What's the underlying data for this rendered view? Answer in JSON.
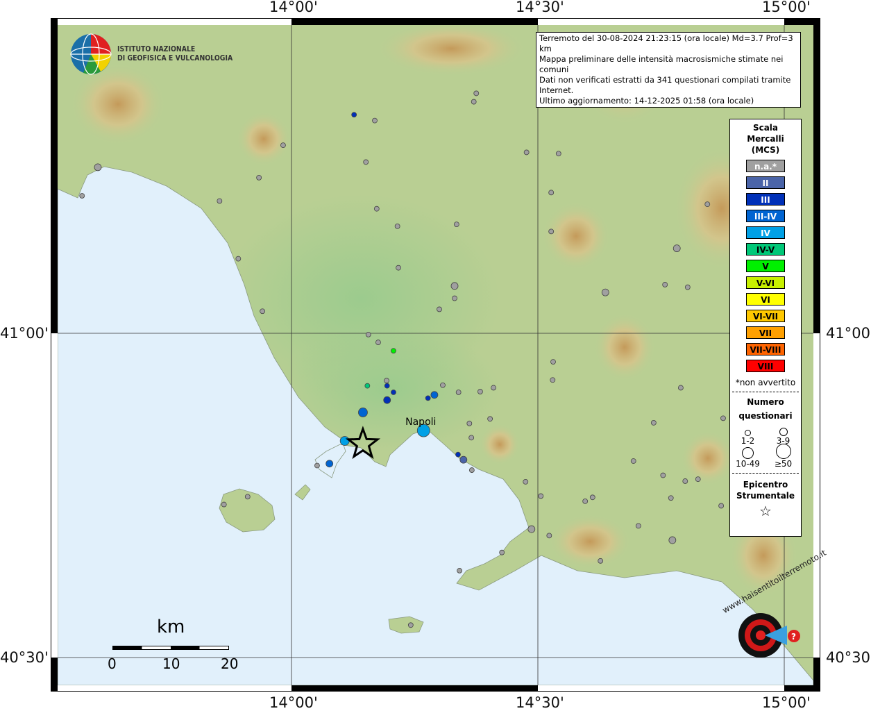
{
  "axes": {
    "top": [
      "14°00'",
      "14°30'",
      "15°00'"
    ],
    "bottom": [
      "14°00'",
      "14°30'",
      "15°00'"
    ],
    "left": [
      "41°00'",
      "40°30'"
    ],
    "right": [
      "41°00'",
      "40°30'"
    ]
  },
  "logo": {
    "line1": "ISTITUTO NAZIONALE",
    "line2": "DI GEOFISICA E VULCANOLOGIA"
  },
  "info": [
    "Terremoto del 30-08-2024 21:23:15 (ora locale) Md=3.7 Prof=3 km",
    "Mappa preliminare delle intensità macrosismiche stimate nei comuni",
    "Dati non verificati estratti da 341 questionari compilati tramite Internet.",
    "Ultimo aggiornamento: 14-12-2025 01:58 (ora locale)"
  ],
  "legend": {
    "title1": "Scala",
    "title2": "Mercalli",
    "title3": "(MCS)",
    "classes": [
      {
        "label": "n.a.*",
        "color": "#a0a0a0",
        "text": "#fff"
      },
      {
        "label": "II",
        "color": "#4a64a8",
        "text": "#fff"
      },
      {
        "label": "III",
        "color": "#0030b8",
        "text": "#fff"
      },
      {
        "label": "III-IV",
        "color": "#0064d2",
        "text": "#fff"
      },
      {
        "label": "IV",
        "color": "#00a0e6",
        "text": "#fff"
      },
      {
        "label": "IV-V",
        "color": "#00c878",
        "text": "#000"
      },
      {
        "label": "V",
        "color": "#00f000",
        "text": "#000"
      },
      {
        "label": "V-VI",
        "color": "#c8f000",
        "text": "#000"
      },
      {
        "label": "VI",
        "color": "#ffff00",
        "text": "#000"
      },
      {
        "label": "VI-VII",
        "color": "#ffc800",
        "text": "#000"
      },
      {
        "label": "VII",
        "color": "#ffa000",
        "text": "#000"
      },
      {
        "label": "VII-VIII",
        "color": "#ff6400",
        "text": "#000"
      },
      {
        "label": "VIII",
        "color": "#ff0000",
        "text": "#000"
      }
    ],
    "note": "*non avvertito",
    "num1": "Numero",
    "num2": "questionari",
    "sizes": [
      "1-2",
      "3-9",
      "10-49",
      "≥50"
    ],
    "epi1": "Epicentro",
    "epi2": "Strumentale"
  },
  "city": {
    "name": "Napoli",
    "lon": 14.268,
    "lat": 40.852
  },
  "epicenter": {
    "lon": 14.145,
    "lat": 40.829
  },
  "scale": {
    "unit": "km",
    "labels": [
      "0",
      "10",
      "20"
    ]
  },
  "brand": "www.haisentitoilterremoto.it",
  "points": [
    [
      14.127,
      41.337,
      "III",
      "1-2"
    ],
    [
      14.169,
      41.328,
      "n.a.",
      "1-2"
    ],
    [
      13.983,
      41.29,
      "n.a.",
      "1-2"
    ],
    [
      13.934,
      41.24,
      "n.a.",
      "1-2"
    ],
    [
      13.854,
      41.204,
      "n.a.",
      "1-2"
    ],
    [
      13.892,
      41.115,
      "n.a.",
      "1-2"
    ],
    [
      13.941,
      41.034,
      "n.a.",
      "1-2"
    ],
    [
      14.151,
      41.264,
      "n.a.",
      "1-2"
    ],
    [
      14.173,
      41.192,
      "n.a.",
      "1-2"
    ],
    [
      14.215,
      41.165,
      "n.a.",
      "1-2"
    ],
    [
      14.335,
      41.168,
      "n.a.",
      "1-2"
    ],
    [
      14.217,
      41.101,
      "n.a.",
      "1-2"
    ],
    [
      14.331,
      41.054,
      "n.a.",
      "1-2"
    ],
    [
      14.3,
      41.037,
      "n.a.",
      "1-2"
    ],
    [
      14.156,
      40.998,
      "n.a.",
      "1-2"
    ],
    [
      14.176,
      40.986,
      "n.a.",
      "1-2"
    ],
    [
      14.375,
      41.37,
      "n.a.",
      "1-2"
    ],
    [
      14.37,
      41.357,
      "n.a.",
      "1-2"
    ],
    [
      14.477,
      41.279,
      "n.a.",
      "1-2"
    ],
    [
      14.542,
      41.277,
      "n.a.",
      "1-2"
    ],
    [
      14.527,
      41.217,
      "n.a.",
      "1-2"
    ],
    [
      14.844,
      41.199,
      "n.a.",
      "1-2"
    ],
    [
      14.527,
      41.157,
      "n.a.",
      "1-2"
    ],
    [
      14.758,
      41.075,
      "n.a.",
      "1-2"
    ],
    [
      14.804,
      41.071,
      "n.a.",
      "1-2"
    ],
    [
      14.531,
      40.956,
      "n.a.",
      "1-2"
    ],
    [
      14.53,
      40.928,
      "n.a.",
      "1-2"
    ],
    [
      14.79,
      40.916,
      "n.a.",
      "1-2"
    ],
    [
      14.876,
      40.869,
      "n.a.",
      "1-2"
    ],
    [
      14.735,
      40.862,
      "n.a.",
      "1-2"
    ],
    [
      14.694,
      40.803,
      "n.a.",
      "1-2"
    ],
    [
      14.754,
      40.781,
      "n.a.",
      "1-2"
    ],
    [
      14.799,
      40.772,
      "n.a.",
      "1-2"
    ],
    [
      14.825,
      40.775,
      "n.a.",
      "1-2"
    ],
    [
      14.872,
      40.734,
      "n.a.",
      "1-2"
    ],
    [
      14.77,
      40.746,
      "n.a.",
      "1-2"
    ],
    [
      14.704,
      40.703,
      "n.a.",
      "1-2"
    ],
    [
      14.611,
      40.747,
      "n.a.",
      "1-2"
    ],
    [
      14.596,
      40.741,
      "n.a.",
      "1-2"
    ],
    [
      14.627,
      40.649,
      "n.a.",
      "1-2"
    ],
    [
      14.523,
      40.688,
      "n.a.",
      "1-2"
    ],
    [
      14.506,
      40.749,
      "n.a.",
      "1-2"
    ],
    [
      14.475,
      40.771,
      "n.a.",
      "1-2"
    ],
    [
      14.427,
      40.662,
      "n.a.",
      "1-2"
    ],
    [
      14.341,
      40.634,
      "n.a.",
      "1-2"
    ],
    [
      14.403,
      40.868,
      "n.a.",
      "1-2"
    ],
    [
      14.361,
      40.861,
      "n.a.",
      "1-2"
    ],
    [
      14.365,
      40.839,
      "n.a.",
      "1-2"
    ],
    [
      14.339,
      40.909,
      "n.a.",
      "1-2"
    ],
    [
      14.383,
      40.91,
      "n.a.",
      "1-2"
    ],
    [
      14.41,
      40.916,
      "n.a.",
      "1-2"
    ],
    [
      14.307,
      40.92,
      "n.a.",
      "1-2"
    ],
    [
      14.366,
      40.789,
      "n.a.",
      "1-2"
    ],
    [
      14.052,
      40.796,
      "n.a.",
      "1-2"
    ],
    [
      13.911,
      40.748,
      "n.a.",
      "1-2"
    ],
    [
      13.863,
      40.736,
      "n.a.",
      "1-2"
    ],
    [
      13.575,
      41.212,
      "n.a.",
      "1-2"
    ],
    [
      14.242,
      40.55,
      "n.a.",
      "1-2"
    ],
    [
      14.193,
      40.927,
      "n.a.",
      "1-2"
    ],
    [
      13.607,
      41.256,
      "n.a.",
      "3-9"
    ],
    [
      14.331,
      41.073,
      "n.a.",
      "3-9"
    ],
    [
      14.782,
      41.131,
      "n.a.",
      "3-9"
    ],
    [
      14.637,
      41.063,
      "n.a.",
      "3-9"
    ],
    [
      14.487,
      40.698,
      "n.a.",
      "3-9"
    ],
    [
      14.773,
      40.681,
      "n.a.",
      "3-9"
    ],
    [
      14.207,
      40.973,
      "V",
      "1-2"
    ],
    [
      14.154,
      40.919,
      "IV-V",
      "1-2"
    ],
    [
      14.194,
      40.919,
      "III",
      "1-2"
    ],
    [
      14.207,
      40.909,
      "III",
      "1-2"
    ],
    [
      14.194,
      40.897,
      "III",
      "3-9"
    ],
    [
      14.277,
      40.9,
      "III",
      "1-2"
    ],
    [
      14.29,
      40.905,
      "III-IV",
      "3-9"
    ],
    [
      14.145,
      40.878,
      "III-IV",
      "10-49"
    ],
    [
      14.268,
      40.85,
      "IV",
      ">=50"
    ],
    [
      14.108,
      40.834,
      "IV",
      "10-49"
    ],
    [
      14.077,
      40.799,
      "III-IV",
      "3-9"
    ],
    [
      14.338,
      40.813,
      "III",
      "1-2"
    ],
    [
      14.349,
      40.805,
      "II",
      "3-9"
    ]
  ]
}
